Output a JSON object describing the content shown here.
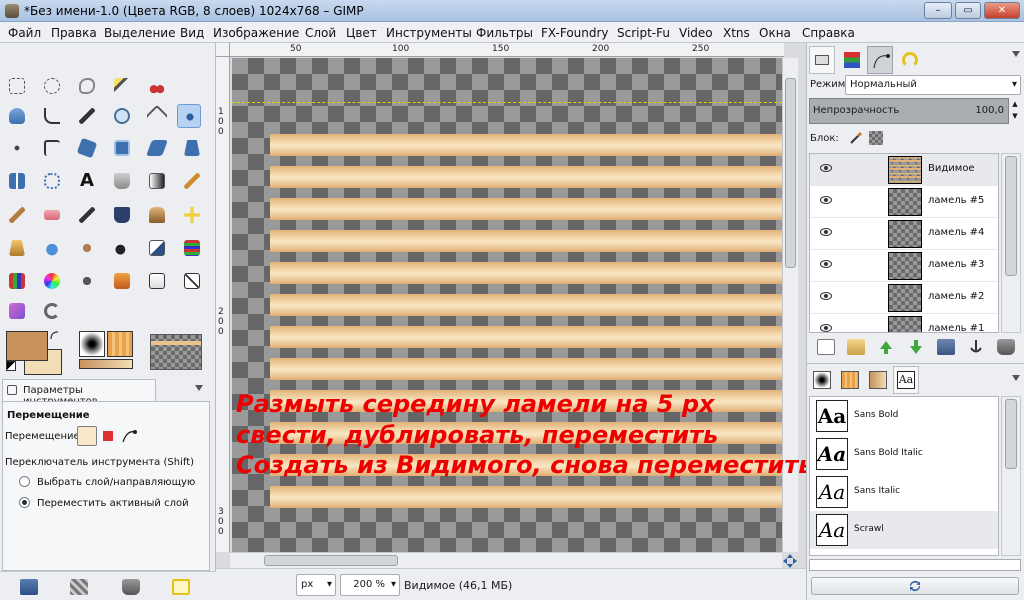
{
  "window": {
    "title": "*Без имени-1.0 (Цвета RGB, 8 слоев) 1024x768 – GIMP"
  },
  "menu": [
    "Файл",
    "Правка",
    "Выделение",
    "Вид",
    "Изображение",
    "Слой",
    "Цвет",
    "Инструменты",
    "Фильтры",
    "FX-Foundry",
    "Script-Fu",
    "Video",
    "Xtns",
    "Окна",
    "Справка"
  ],
  "ruler": {
    "top": [
      "50",
      "100",
      "150",
      "200",
      "250"
    ],
    "left": [
      "100",
      "200",
      "300"
    ]
  },
  "tool_options": {
    "tab_label": "Параметры инструментов",
    "heading": "Перемещение",
    "move_label": "Перемещение:",
    "switch_label": "Переключатель инструмента  (Shift)",
    "radio_1": "Выбрать слой/направляющую",
    "radio_2": "Переместить активный слой"
  },
  "overlay": {
    "line1": "Размыть середину ламели на 5 px",
    "line2": "свести, дублировать, переместить",
    "line3": "Создать из Видимого, снова переместить"
  },
  "status": {
    "unit": "px",
    "zoom": "200 %",
    "info": "Видимое (46,1 МБ)"
  },
  "layers_panel": {
    "mode_label": "Режим:",
    "mode_value": "Нормальный",
    "opacity_label": "Непрозрачность",
    "opacity_value": "100,0",
    "lock_label": "Блок:",
    "layers": [
      "Видимое",
      "ламель #5",
      "ламель #4",
      "ламель #3",
      "ламель #2",
      "ламель #1"
    ]
  },
  "fonts_panel": {
    "preview_char": "Aa",
    "fonts": [
      "Sans Bold",
      "Sans Bold Italic",
      "Sans Italic",
      "Scrawl"
    ]
  },
  "colors": {
    "foreground": "#c8925c",
    "background": "#f2ddb6",
    "overlay_text": "#ee0000"
  }
}
